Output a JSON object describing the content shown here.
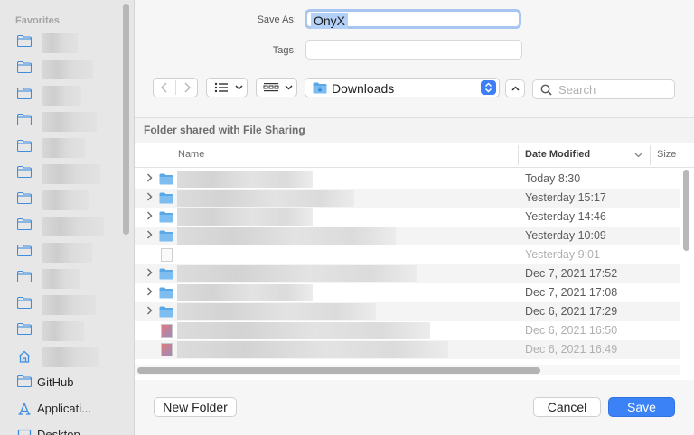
{
  "sidebar": {
    "title": "Favorites",
    "items": [
      {
        "label": "",
        "icon": "folder-icon"
      },
      {
        "label": "",
        "icon": "folder-icon"
      },
      {
        "label": "",
        "icon": "folder-icon"
      },
      {
        "label": "",
        "icon": "folder-icon"
      },
      {
        "label": "",
        "icon": "folder-icon"
      },
      {
        "label": "",
        "icon": "folder-icon"
      },
      {
        "label": "",
        "icon": "folder-icon"
      },
      {
        "label": "",
        "icon": "folder-icon"
      },
      {
        "label": "",
        "icon": "folder-icon"
      },
      {
        "label": "",
        "icon": "folder-icon"
      },
      {
        "label": "",
        "icon": "folder-icon"
      },
      {
        "label": "",
        "icon": "folder-icon"
      },
      {
        "label": "",
        "icon": "home-icon"
      },
      {
        "label": "GitHub",
        "icon": "folder-icon"
      },
      {
        "label": "Applicati...",
        "icon": "applications-icon"
      },
      {
        "label": "Desktop",
        "icon": "desktop-icon"
      }
    ]
  },
  "form": {
    "save_as_label": "Save As:",
    "save_as_value": "OnyX",
    "tags_label": "Tags:"
  },
  "toolbar": {
    "location": "Downloads",
    "search_placeholder": "Search"
  },
  "browser": {
    "shared_header": "Folder shared with File Sharing",
    "columns": {
      "name": "Name",
      "date": "Date Modified",
      "size": "Size"
    },
    "rows": [
      {
        "type": "folder",
        "date": "Today 8:30",
        "dim": false
      },
      {
        "type": "folder",
        "date": "Yesterday 15:17",
        "dim": false
      },
      {
        "type": "folder",
        "date": "Yesterday 14:46",
        "dim": false
      },
      {
        "type": "folder",
        "date": "Yesterday 10:09",
        "dim": false
      },
      {
        "type": "file",
        "date": "Yesterday 9:01",
        "dim": true
      },
      {
        "type": "folder",
        "date": "Dec 7, 2021 17:52",
        "dim": false
      },
      {
        "type": "folder",
        "date": "Dec 7, 2021 17:08",
        "dim": false
      },
      {
        "type": "folder",
        "date": "Dec 6, 2021 17:29",
        "dim": false
      },
      {
        "type": "image",
        "date": "Dec 6, 2021 16:50",
        "dim": true
      },
      {
        "type": "image",
        "date": "Dec 6, 2021 16:49",
        "dim": true
      }
    ]
  },
  "buttons": {
    "new_folder": "New Folder",
    "cancel": "Cancel",
    "save": "Save"
  },
  "colors": {
    "accent": "#3b82f6",
    "folder": "#5ba8e6"
  }
}
